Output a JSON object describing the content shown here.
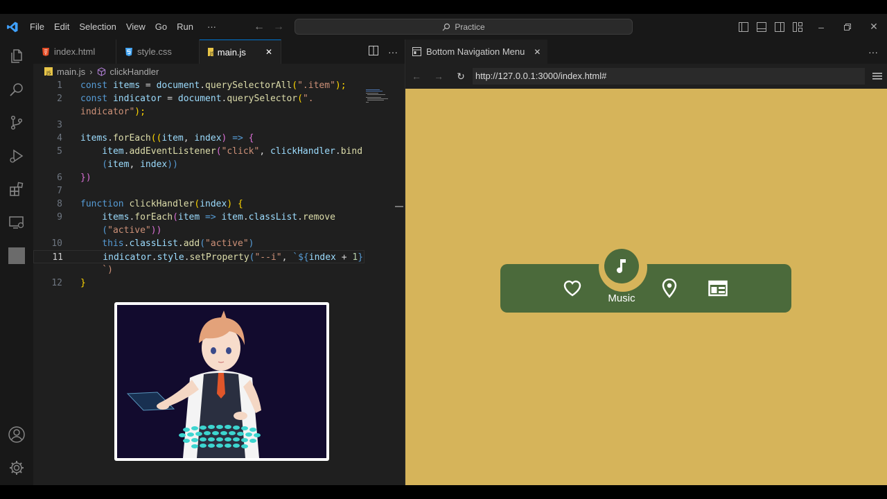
{
  "menubar": {
    "items": [
      "File",
      "Edit",
      "Selection",
      "View",
      "Go",
      "Run"
    ],
    "more": "···",
    "search_text": "Practice"
  },
  "editor": {
    "tabs": [
      {
        "label": "index.html",
        "icon": "html-file-icon"
      },
      {
        "label": "style.css",
        "icon": "css-file-icon"
      },
      {
        "label": "main.js",
        "icon": "js-file-icon",
        "active": true
      }
    ],
    "breadcrumb": {
      "file": "main.js",
      "symbol": "clickHandler"
    },
    "line_numbers": [
      "1",
      "2",
      "",
      "3",
      "4",
      "5",
      "",
      "6",
      "7",
      "8",
      "9",
      "",
      "10",
      "11",
      "",
      "12"
    ],
    "current_line": "11",
    "code": {
      "l1a": "const",
      "l1b": " items",
      "l1c": " = ",
      "l1d": "document",
      "l1e": ".",
      "l1f": "querySelectorAll",
      "l1g": "(",
      "l1h": "\".item\"",
      "l1i": ");",
      "l2a": "const",
      "l2b": " indicator",
      "l2c": " = ",
      "l2d": "document",
      "l2e": ".",
      "l2f": "querySelector",
      "l2g": "(",
      "l2h": "\".",
      "l2w": "indicator\"",
      "l2x": ");",
      "l4a": "items",
      "l4b": ".",
      "l4c": "forEach",
      "l4d": "((",
      "l4e": "item",
      "l4f": ", ",
      "l4g": "index",
      "l4h": ") ",
      "l4i": "=>",
      "l4j": " {",
      "l5a": "    item",
      "l5b": ".",
      "l5c": "addEventListener",
      "l5d": "(",
      "l5e": "\"click\"",
      "l5f": ", ",
      "l5g": "clickHandler",
      "l5h": ".",
      "l5i": "bind",
      "l5w1": "    (",
      "l5w2": "item",
      "l5w3": ", ",
      "l5w4": "index",
      "l5w5": "))",
      "l6a": "})",
      "l8a": "function",
      "l8b": " clickHandler",
      "l8c": "(",
      "l8d": "index",
      "l8e": ") {",
      "l9a": "    items",
      "l9b": ".",
      "l9c": "forEach",
      "l9d": "(",
      "l9e": "item",
      "l9f": " => ",
      "l9g": "item",
      "l9h": ".",
      "l9i": "classList",
      "l9j": ".",
      "l9k": "remove",
      "l9w1": "    (",
      "l9w2": "\"active\"",
      "l9w3": "))",
      "l10a": "    this",
      "l10b": ".",
      "l10c": "classList",
      "l10d": ".",
      "l10e": "add",
      "l10f": "(",
      "l10g": "\"active\"",
      "l10h": ")",
      "l11a": "    indicator",
      "l11b": ".",
      "l11c": "style",
      "l11d": ".",
      "l11e": "setProperty",
      "l11f": "(",
      "l11g": "\"--i\"",
      "l11h": ", ",
      "l11i": "`${",
      "l11j": "index",
      "l11k": " + ",
      "l11l": "1",
      "l11m": "}",
      "l11w": "    `)",
      "l12a": "}"
    }
  },
  "browser": {
    "tab_title": "Bottom Navigation Menu",
    "url": "http://127.0.0.1:3000/index.html#",
    "page_bg": "#d6b45a",
    "nav": {
      "bg": "#4b6a3b",
      "active_label": "Music",
      "items": [
        "heart-icon",
        "music-note-icon",
        "location-pin-icon",
        "newspaper-icon"
      ]
    }
  },
  "colors": {
    "accent": "#0078d4",
    "js_icon": "#e8c547"
  }
}
